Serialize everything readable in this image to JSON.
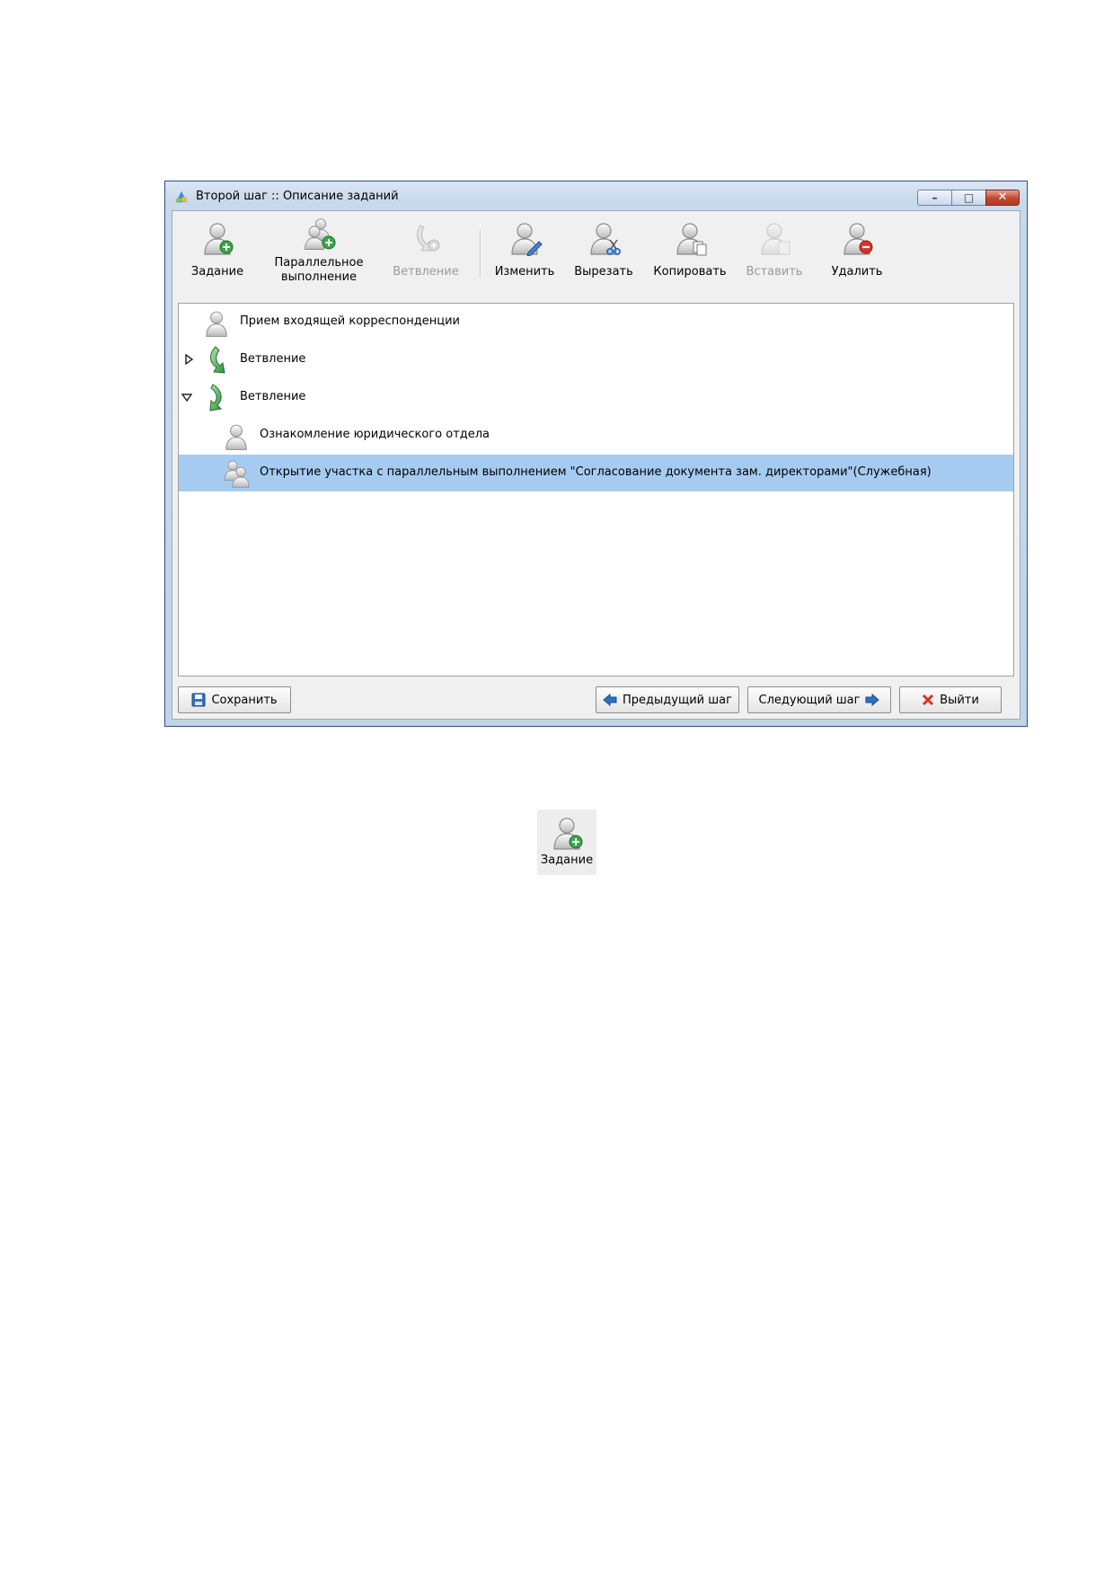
{
  "window": {
    "title": "Второй шаг :: Описание заданий",
    "controls": {
      "minimize": "–",
      "maximize": "□",
      "close": "✕"
    }
  },
  "toolbar": {
    "task_label": "Задание",
    "parallel_label_line1": "Параллельное",
    "parallel_label_line2": "выполнение",
    "branch_label": "Ветвление",
    "edit_label": "Изменить",
    "cut_label": "Вырезать",
    "copy_label": "Копировать",
    "paste_label": "Вставить",
    "delete_label": "Удалить",
    "disabled": [
      "Ветвление",
      "Вставить"
    ]
  },
  "tree": {
    "nodes": [
      {
        "label": "Прием входящей корреспонденции",
        "icon": "user-icon"
      },
      {
        "label": "Ветвление",
        "icon": "branch-icon",
        "expander": "collapsed"
      },
      {
        "label": "Ветвление",
        "icon": "branch-icon",
        "expander": "expanded"
      },
      {
        "label": "Ознакомление юридического отдела",
        "icon": "user-icon"
      },
      {
        "label": "Открытие участка с параллельным выполнением \"Согласование документа зам. директорами\"(Служебная)",
        "icon": "users-icon",
        "selected": true
      }
    ]
  },
  "buttons": {
    "save": "Сохранить",
    "prev": "Предыдущий шаг",
    "next": "Следующий шаг",
    "exit": "Выйти"
  },
  "sample_button": {
    "label": "Задание"
  },
  "colors": {
    "selection": "#a6cbf0",
    "title_bar": "#c9d9ec",
    "green_accent": "#3aa64b",
    "red_accent": "#d6322b",
    "blue_arrow": "#2f6fc6"
  }
}
